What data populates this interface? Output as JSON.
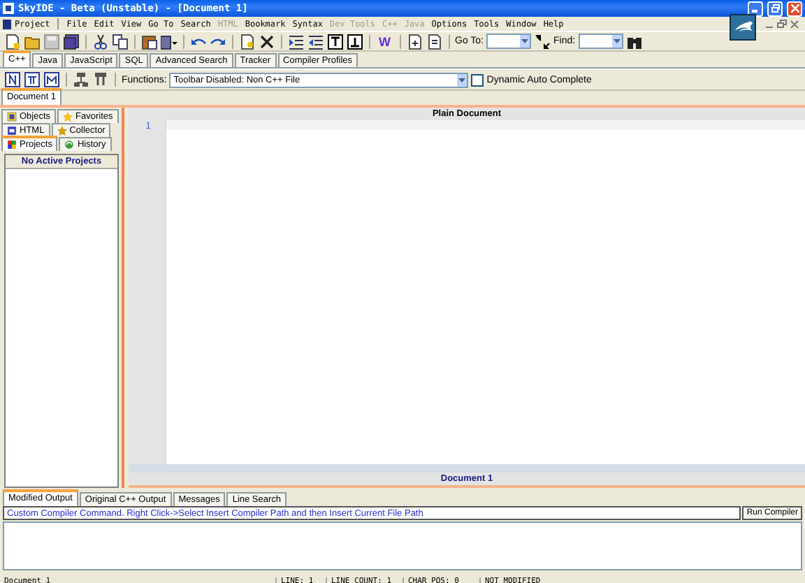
{
  "window": {
    "title": "SkyIDE - Beta (Unstable) - [Document 1]"
  },
  "menu": [
    {
      "label": "Project",
      "disabled": false
    },
    {
      "label": "File",
      "disabled": false
    },
    {
      "label": "Edit",
      "disabled": false
    },
    {
      "label": "View",
      "disabled": false
    },
    {
      "label": "Go To",
      "disabled": false
    },
    {
      "label": "Search",
      "disabled": false
    },
    {
      "label": "HTML",
      "disabled": true
    },
    {
      "label": "Bookmark",
      "disabled": false
    },
    {
      "label": "Syntax",
      "disabled": false
    },
    {
      "label": "Dev Tools",
      "disabled": true
    },
    {
      "label": "C++",
      "disabled": true
    },
    {
      "label": "Java",
      "disabled": true
    },
    {
      "label": "Options",
      "disabled": false
    },
    {
      "label": "Tools",
      "disabled": false
    },
    {
      "label": "Window",
      "disabled": false
    },
    {
      "label": "Help",
      "disabled": false
    }
  ],
  "toolbar": {
    "word_button": "W",
    "goto_label": "Go To:",
    "find_label": "Find:"
  },
  "language_tabs": [
    {
      "label": "C++",
      "selected": true
    },
    {
      "label": "Java",
      "selected": false
    },
    {
      "label": "JavaScript",
      "selected": false
    },
    {
      "label": "SQL",
      "selected": false
    },
    {
      "label": "Advanced Search",
      "selected": false
    },
    {
      "label": "Tracker",
      "selected": false
    },
    {
      "label": "Compiler Profiles",
      "selected": false
    }
  ],
  "functions_bar": {
    "label": "Functions:",
    "value": "Toolbar Disabled: Non C++ File",
    "auto_complete": {
      "label": "Dynamic Auto Complete",
      "checked": false
    }
  },
  "document_tabs": [
    {
      "label": "Document 1",
      "selected": true
    }
  ],
  "side_tabs": [
    [
      {
        "label": "Objects",
        "selected": false
      },
      {
        "label": "Favorites",
        "selected": false
      }
    ],
    [
      {
        "label": "HTML",
        "selected": false
      },
      {
        "label": "Collector",
        "selected": false
      }
    ],
    [
      {
        "label": "Projects",
        "selected": true
      },
      {
        "label": "History",
        "selected": false
      }
    ]
  ],
  "projects": {
    "header": "No Active Projects"
  },
  "editor": {
    "title": "Plain Document",
    "line_numbers": [
      "1"
    ],
    "footer": "Document 1"
  },
  "output_tabs": [
    {
      "label": "Modified Output",
      "selected": true
    },
    {
      "label": "Original C++ Output",
      "selected": false
    },
    {
      "label": "Messages",
      "selected": false
    },
    {
      "label": "Line Search",
      "selected": false
    }
  ],
  "compiler": {
    "command": "Custom Compiler Command. Right Click->Select Insert Compiler Path and then Insert Current File Path",
    "button": "Run Compiler"
  },
  "status_bar": [
    "Document 1",
    "LINE: 1",
    "LINE COUNT: 1",
    "CHAR POS: 0",
    "NOT MODIFIED"
  ]
}
